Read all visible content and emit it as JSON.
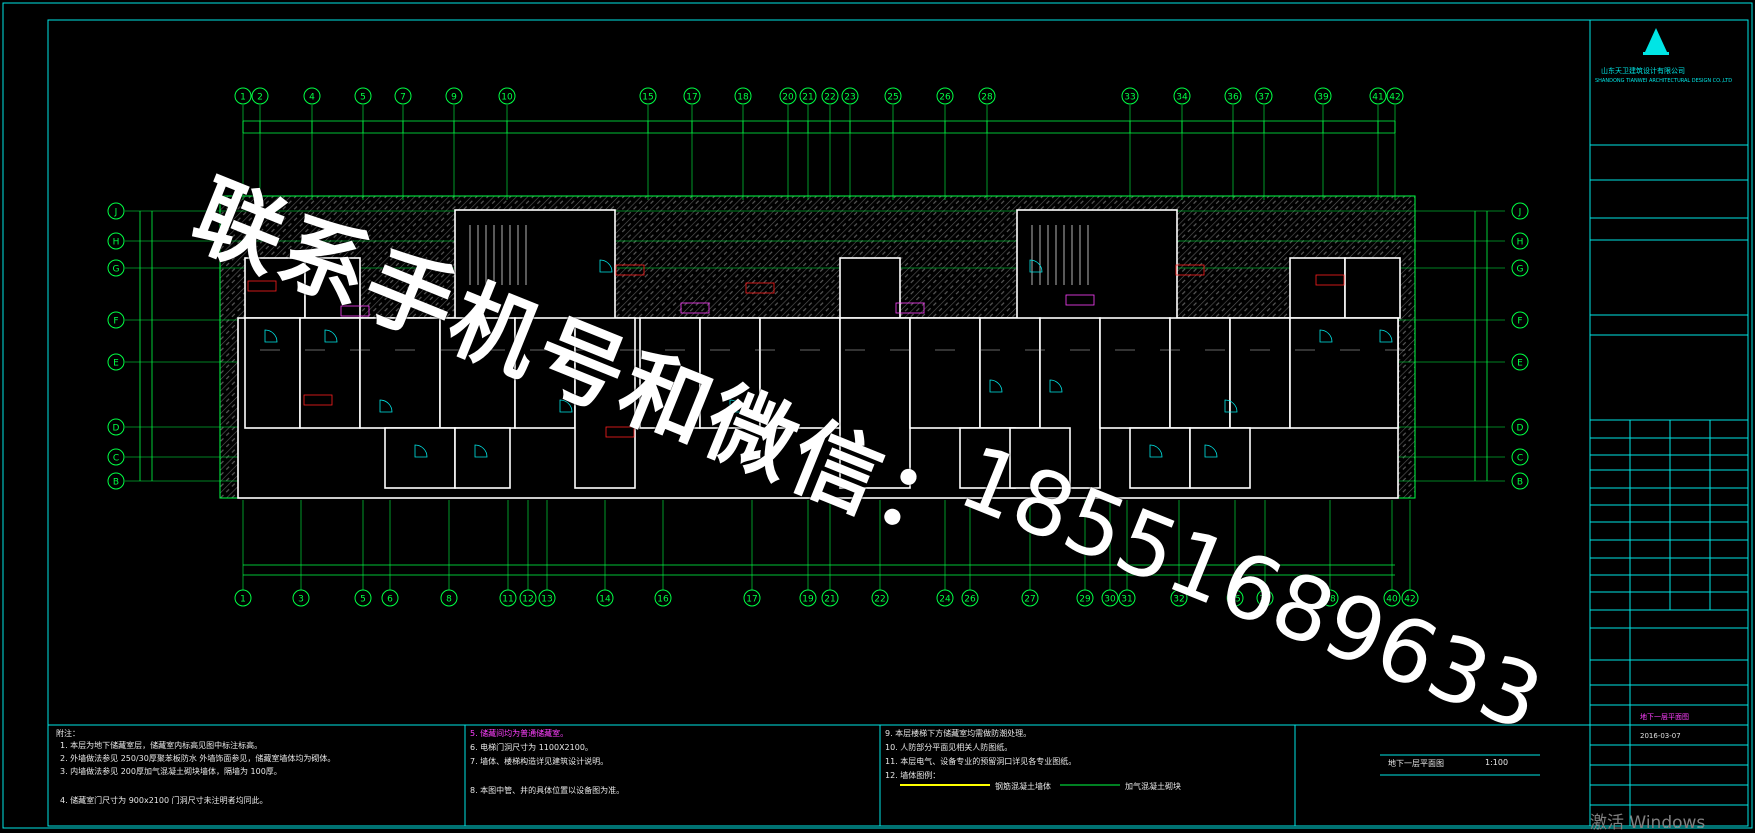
{
  "colors": {
    "background": "#000000",
    "frame": "#00e5e5",
    "axis": "#00ff44",
    "wall": "#ffffff",
    "door": "#00e5e5",
    "text": "#e0e0e0",
    "room_red": "#ff2020",
    "room_magenta": "#ff40ff"
  },
  "axes_top": [
    "1",
    "2",
    "4",
    "5",
    "7",
    "9",
    "10",
    "15",
    "17",
    "18",
    "20",
    "21",
    "22",
    "23",
    "25",
    "26",
    "28",
    "33",
    "34",
    "36",
    "37",
    "39",
    "41",
    "42"
  ],
  "axes_bottom": [
    "1",
    "3",
    "5",
    "6",
    "8",
    "11",
    "12",
    "13",
    "14",
    "16",
    "17",
    "19",
    "21",
    "22",
    "24",
    "26",
    "27",
    "29",
    "30",
    "31",
    "32",
    "35",
    "37",
    "38",
    "40",
    "42"
  ],
  "axes_rows": [
    "J",
    "H",
    "G",
    "F",
    "E",
    "D",
    "C",
    "B"
  ],
  "watermark": {
    "text": "联系手机号和微信：",
    "phone": "18551689633"
  },
  "title_block": {
    "company": "山东天卫建筑设计有限公司",
    "company_en": "SHANDONG TIANWEI ARCHITECTURAL DESIGN CO.,LTD",
    "drawing_title": "地下一层平面图",
    "scale": "1:100",
    "date": "2016-03-07"
  },
  "notes_header": "附注：",
  "notes": [
    "1. 本层为地下储藏室层，储藏室内标高见图中标注标高。",
    "2. 外墙做法参见 250/30厚聚苯板防水 外墙饰面参见，储藏室墙体均为砌体。",
    "3. 内墙做法参见 200厚加气混凝土砌块墙体，隔墙为 100厚。",
    "4. 储藏室门尺寸为 900x2100 门洞尺寸未注明者均同此。",
    "5. 储藏间均为普通储藏室。",
    "6. 电梯门洞尺寸为 1100X2100。",
    "7. 墙体、楼梯构造详见建筑设计说明。",
    "8. 本图中管、井的具体位置以设备图为准。"
  ],
  "notes_right": [
    "9. 本层楼梯下方储藏室均需做防潮处理。",
    "10. 人防部分平面见相关人防图纸。",
    "11. 本层电气、设备专业的预留洞口详见各专业图纸。",
    "12. 墙体图例："
  ],
  "legend": [
    "钢筋混凝土墙体",
    "加气混凝土砌块"
  ],
  "title_footer": [
    "地下一层平面图",
    "1:100"
  ],
  "os_watermark": "激活 Windows"
}
